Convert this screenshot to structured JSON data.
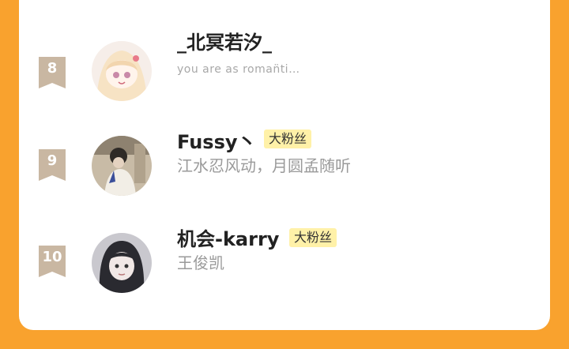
{
  "colors": {
    "background": "#F9A22E",
    "card": "#FFFFFF",
    "rank_badge": "#C9B7A2",
    "fan_badge_bg": "#FFF1A8",
    "name_text": "#222222",
    "signature_text": "#9A9A9A"
  },
  "rows": [
    {
      "rank": "8",
      "name": "_北冥若汐_",
      "fan_badge": "",
      "signature": "you are as roman̈ti…"
    },
    {
      "rank": "9",
      "name": "Fussy丶",
      "fan_badge": "大粉丝",
      "signature": "江水忍风动，月圆孟随听"
    },
    {
      "rank": "10",
      "name": "机会-karry",
      "fan_badge": "大粉丝",
      "signature": "王俊凯"
    }
  ]
}
